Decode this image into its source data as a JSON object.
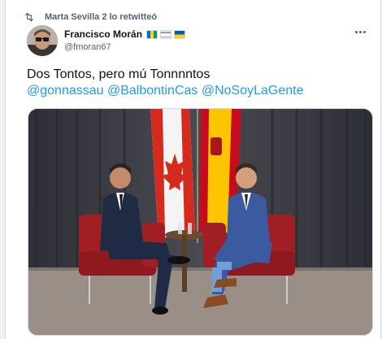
{
  "retweet": {
    "icon": "retweet-icon",
    "text": "Marta Sevilla 2 lo retwitteó"
  },
  "author": {
    "name": "Francisco Morán",
    "handle": "@fmoran67",
    "flags": [
      "saint-vincent-flag",
      "israel-flag",
      "ukraine-flag"
    ]
  },
  "tweet": {
    "text": "Dos Tontos, pero mú Tonnnntos",
    "mentions": [
      "@gonnassau",
      "@BalbontinCas",
      "@NoSoyLaGente"
    ]
  },
  "media": {
    "description_icon": "photo",
    "colors": {
      "curtain": "#3c3c44",
      "floor": "#9a8f87",
      "chair": "#a01e24",
      "canada_red": "#d52b1e",
      "spain_red": "#c60b1e",
      "spain_yellow": "#ffc400"
    }
  },
  "colors": {
    "accent": "#1d9bf0",
    "text": "#0f1419",
    "muted": "#536471"
  }
}
